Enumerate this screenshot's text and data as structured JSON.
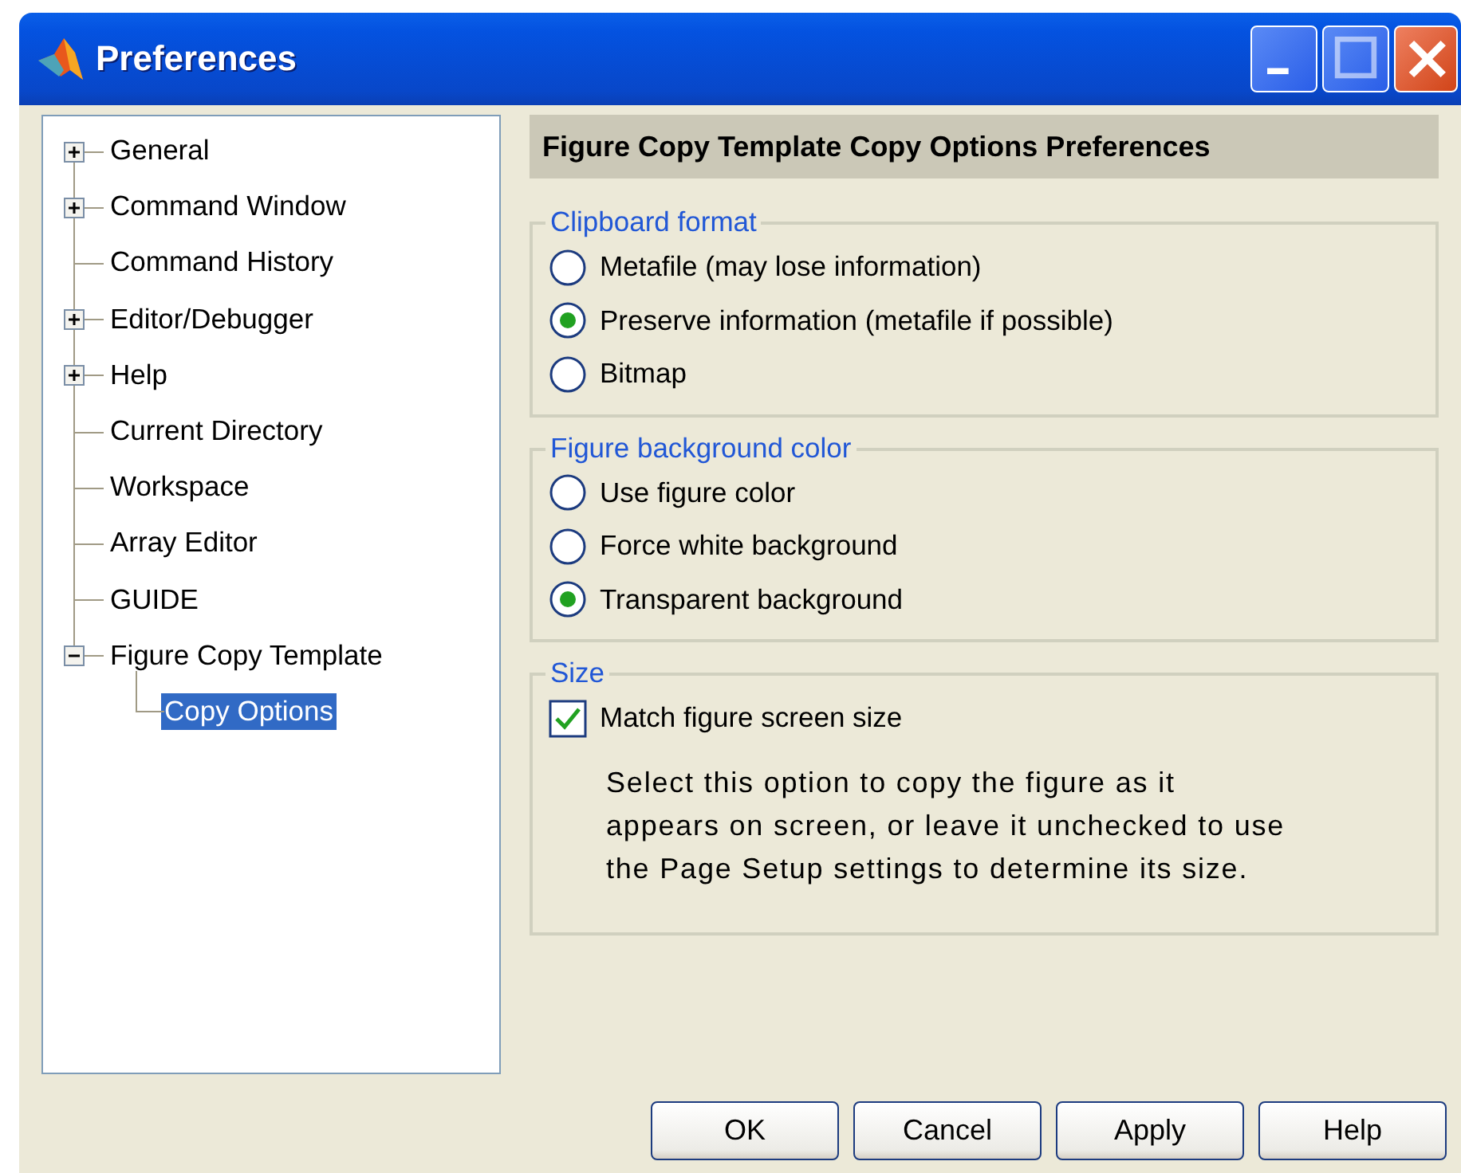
{
  "window": {
    "title": "Preferences"
  },
  "tree": [
    {
      "label": "General",
      "kind": "branch",
      "expanded": false,
      "selected": false
    },
    {
      "label": "Command Window",
      "kind": "branch",
      "expanded": false,
      "selected": false
    },
    {
      "label": "Command History",
      "kind": "leaf",
      "selected": false
    },
    {
      "label": "Editor/Debugger",
      "kind": "branch",
      "expanded": false,
      "selected": false
    },
    {
      "label": "Help",
      "kind": "branch",
      "expanded": false,
      "selected": false
    },
    {
      "label": "Current Directory",
      "kind": "leaf",
      "selected": false
    },
    {
      "label": "Workspace",
      "kind": "leaf",
      "selected": false
    },
    {
      "label": "Array Editor",
      "kind": "leaf",
      "selected": false
    },
    {
      "label": "GUIDE",
      "kind": "leaf",
      "selected": false
    },
    {
      "label": "Figure Copy Template",
      "kind": "branch",
      "expanded": true,
      "selected": false,
      "children": [
        {
          "label": "Copy Options",
          "selected": true
        }
      ]
    }
  ],
  "panel_title": "Figure Copy Template Copy Options Preferences",
  "groups": [
    {
      "title": "Clipboard format",
      "options": [
        {
          "kind": "radio",
          "label": "Metafile (may lose information)",
          "selected": false
        },
        {
          "kind": "radio",
          "label": "Preserve information (metafile if possible)",
          "selected": true
        },
        {
          "kind": "radio",
          "label": "Bitmap",
          "selected": false
        }
      ]
    },
    {
      "title": "Figure background color",
      "options": [
        {
          "kind": "radio",
          "label": "Use figure color",
          "selected": false
        },
        {
          "kind": "radio",
          "label": "Force white background",
          "selected": false
        },
        {
          "kind": "radio",
          "label": "Transparent background",
          "selected": true
        }
      ]
    },
    {
      "title": "Size",
      "options": [
        {
          "kind": "checkbox",
          "label": "Match figure screen size",
          "checked": true
        },
        {
          "kind": "note",
          "text": "Select this option to copy the figure as it appears on screen, or leave it unchecked to use the Page Setup settings to determine its size."
        }
      ]
    }
  ],
  "buttons": [
    "OK",
    "Cancel",
    "Apply",
    "Help"
  ]
}
